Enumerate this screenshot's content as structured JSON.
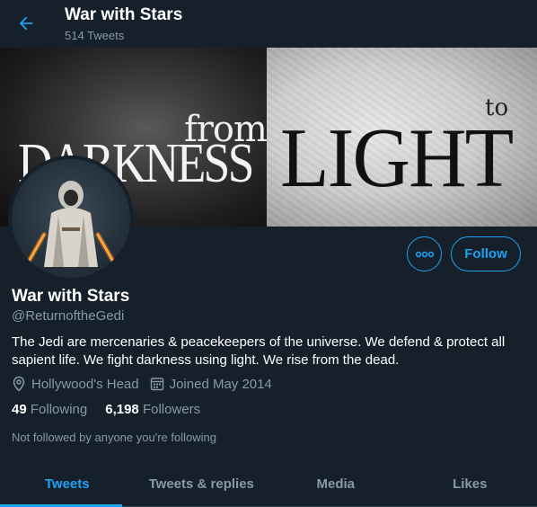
{
  "header": {
    "title": "War with Stars",
    "subtitle": "514 Tweets"
  },
  "banner": {
    "word_from": "from",
    "word_darkness": "DARKNESS",
    "word_to": "to",
    "word_light": "LIGHT"
  },
  "profile": {
    "name": "War with Stars",
    "handle": "@ReturnoftheGedi",
    "bio": "The Jedi are mercenaries & peacekeepers of the universe. We defend & protect all sapient life. We fight darkness using light. We rise from the dead.",
    "location": "Hollywood's Head",
    "joined": "Joined May 2014",
    "following_count": "49",
    "following_label": "Following",
    "followers_count": "6,198",
    "followers_label": "Followers",
    "not_followed": "Not followed by anyone you're following"
  },
  "actions": {
    "more_label": "∘∘∘",
    "follow_label": "Follow"
  },
  "tabs": [
    {
      "label": "Tweets",
      "active": true
    },
    {
      "label": "Tweets & replies",
      "active": false
    },
    {
      "label": "Media",
      "active": false
    },
    {
      "label": "Likes",
      "active": false
    }
  ],
  "colors": {
    "accent": "#1da1f2",
    "background": "#15202b",
    "secondary_text": "#8899a6"
  },
  "icons": [
    "back-arrow-icon",
    "location-pin-icon",
    "calendar-icon",
    "more-icon"
  ]
}
